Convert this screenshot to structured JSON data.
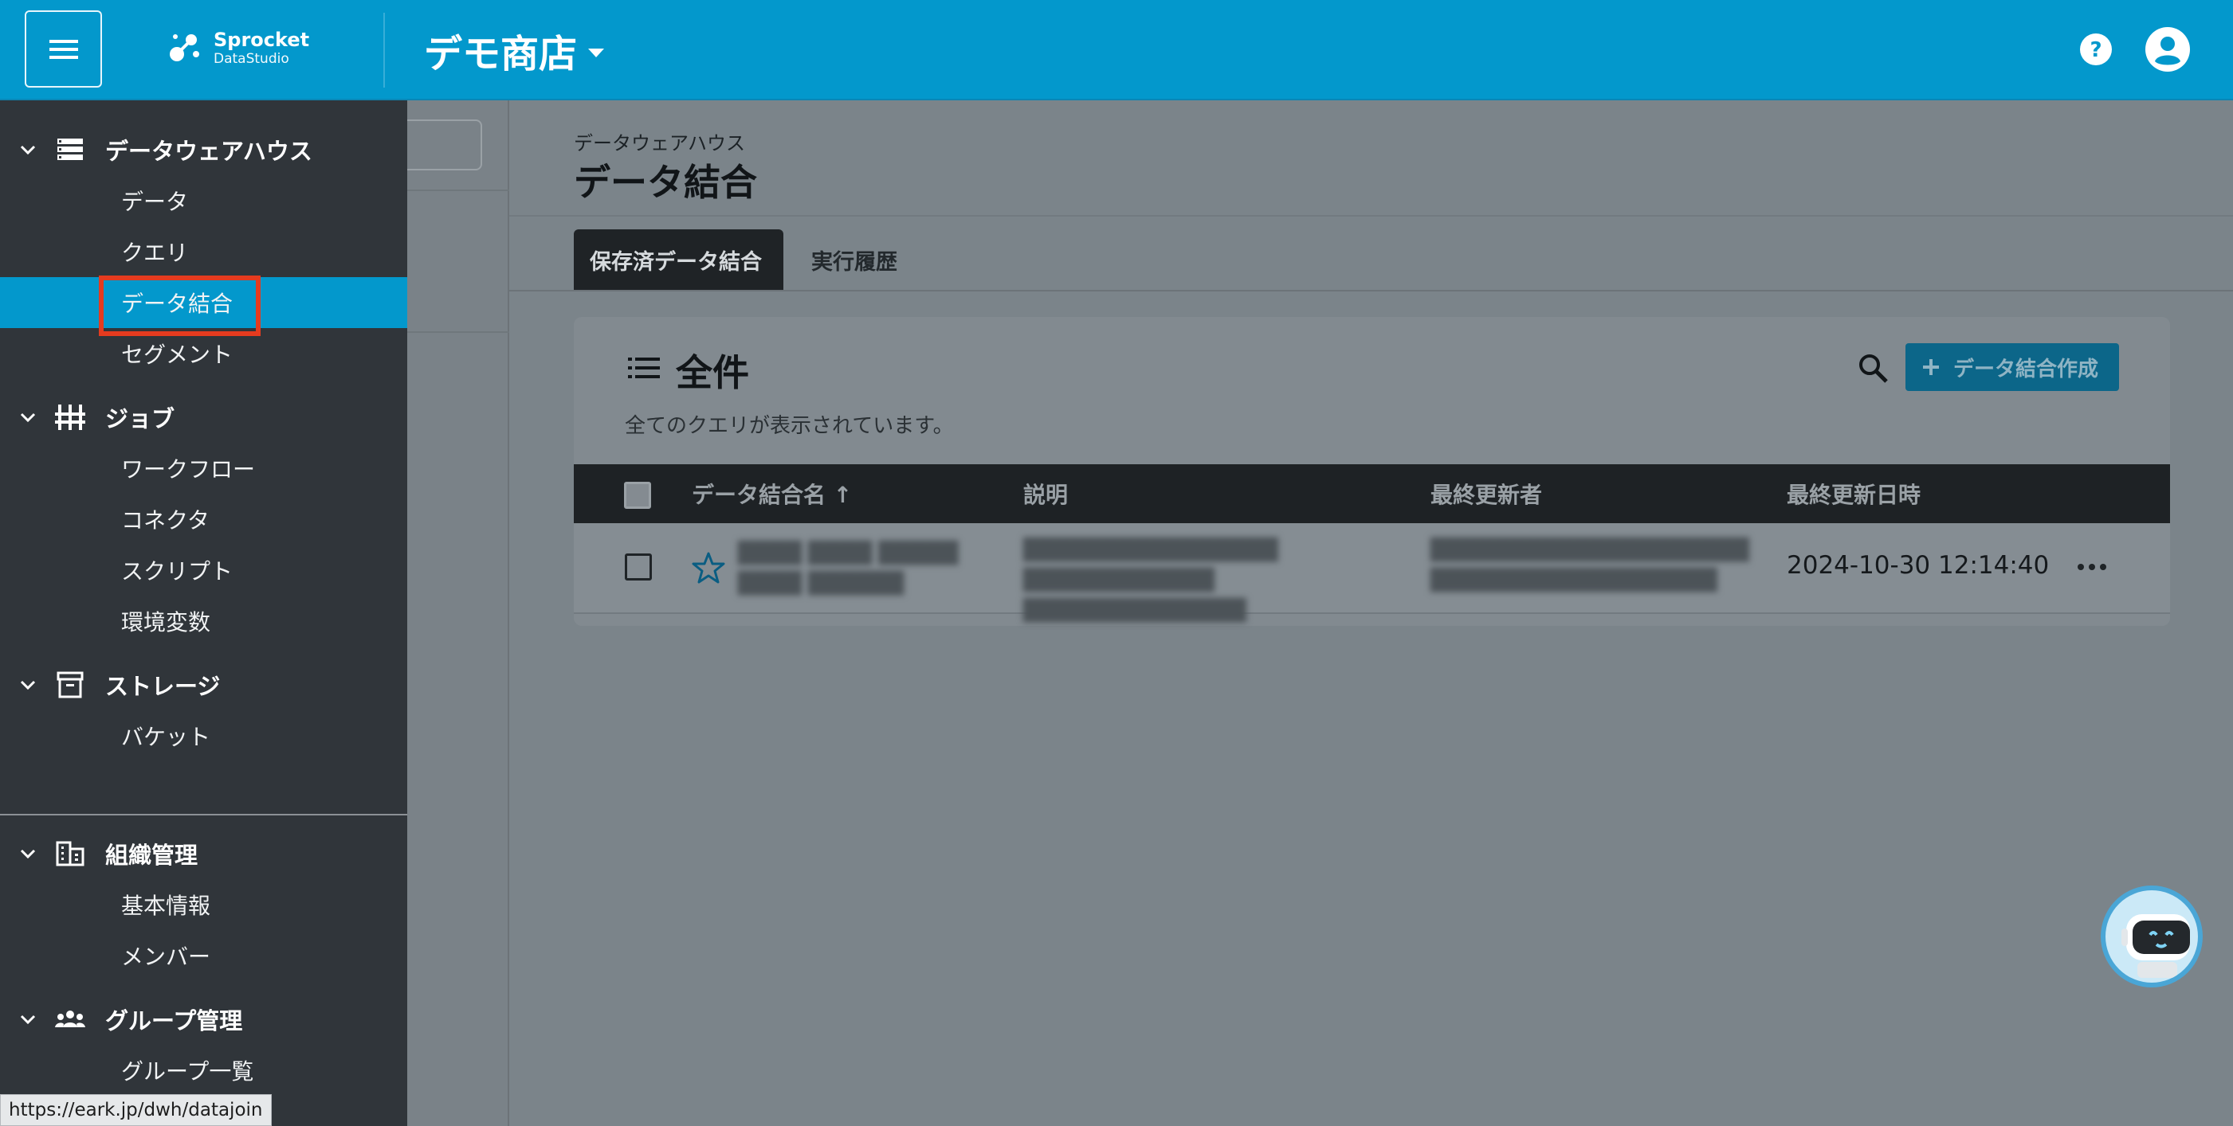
{
  "header": {
    "logo_name": "Sprocket",
    "logo_sub": "DataStudio",
    "store_name": "デモ商店"
  },
  "sidebar": {
    "sections": [
      {
        "label": "データウェアハウス",
        "items": [
          "データ",
          "クエリ",
          "データ結合",
          "セグメント"
        ]
      },
      {
        "label": "ジョブ",
        "items": [
          "ワークフロー",
          "コネクタ",
          "スクリプト",
          "環境変数"
        ]
      },
      {
        "label": "ストレージ",
        "items": [
          "バケット"
        ]
      },
      {
        "label": "組織管理",
        "items": [
          "基本情報",
          "メンバー"
        ]
      },
      {
        "label": "グループ管理",
        "items": [
          "グループ一覧"
        ]
      }
    ],
    "active_item": "データ結合"
  },
  "status_url": "https://eark.jp/dwh/datajoin",
  "main": {
    "breadcrumb": "データウェアハウス",
    "title": "データ結合",
    "tabs": [
      {
        "label": "保存済データ結合",
        "active": true
      },
      {
        "label": "実行履歴",
        "active": false
      }
    ],
    "card": {
      "title": "全件",
      "subtitle": "全てのクエリが表示されています。",
      "create_button": "データ結合作成"
    },
    "table": {
      "columns": [
        "データ結合名 ↑",
        "説明",
        "最終更新者",
        "最終更新日時"
      ],
      "rows": [
        {
          "name_blurred": "████ ████ █████ ████ ██████",
          "desc_blurred": "████████████████ ████████████ ██████████████",
          "updater_blurred": "████████████████████ ██████████████████",
          "updated_at": "2024-10-30 12:14:40"
        }
      ]
    }
  },
  "colors": {
    "header": "#0398cc",
    "sidebar": "#30353a",
    "active": "#0398cc",
    "highlight": "#e53b1f"
  }
}
